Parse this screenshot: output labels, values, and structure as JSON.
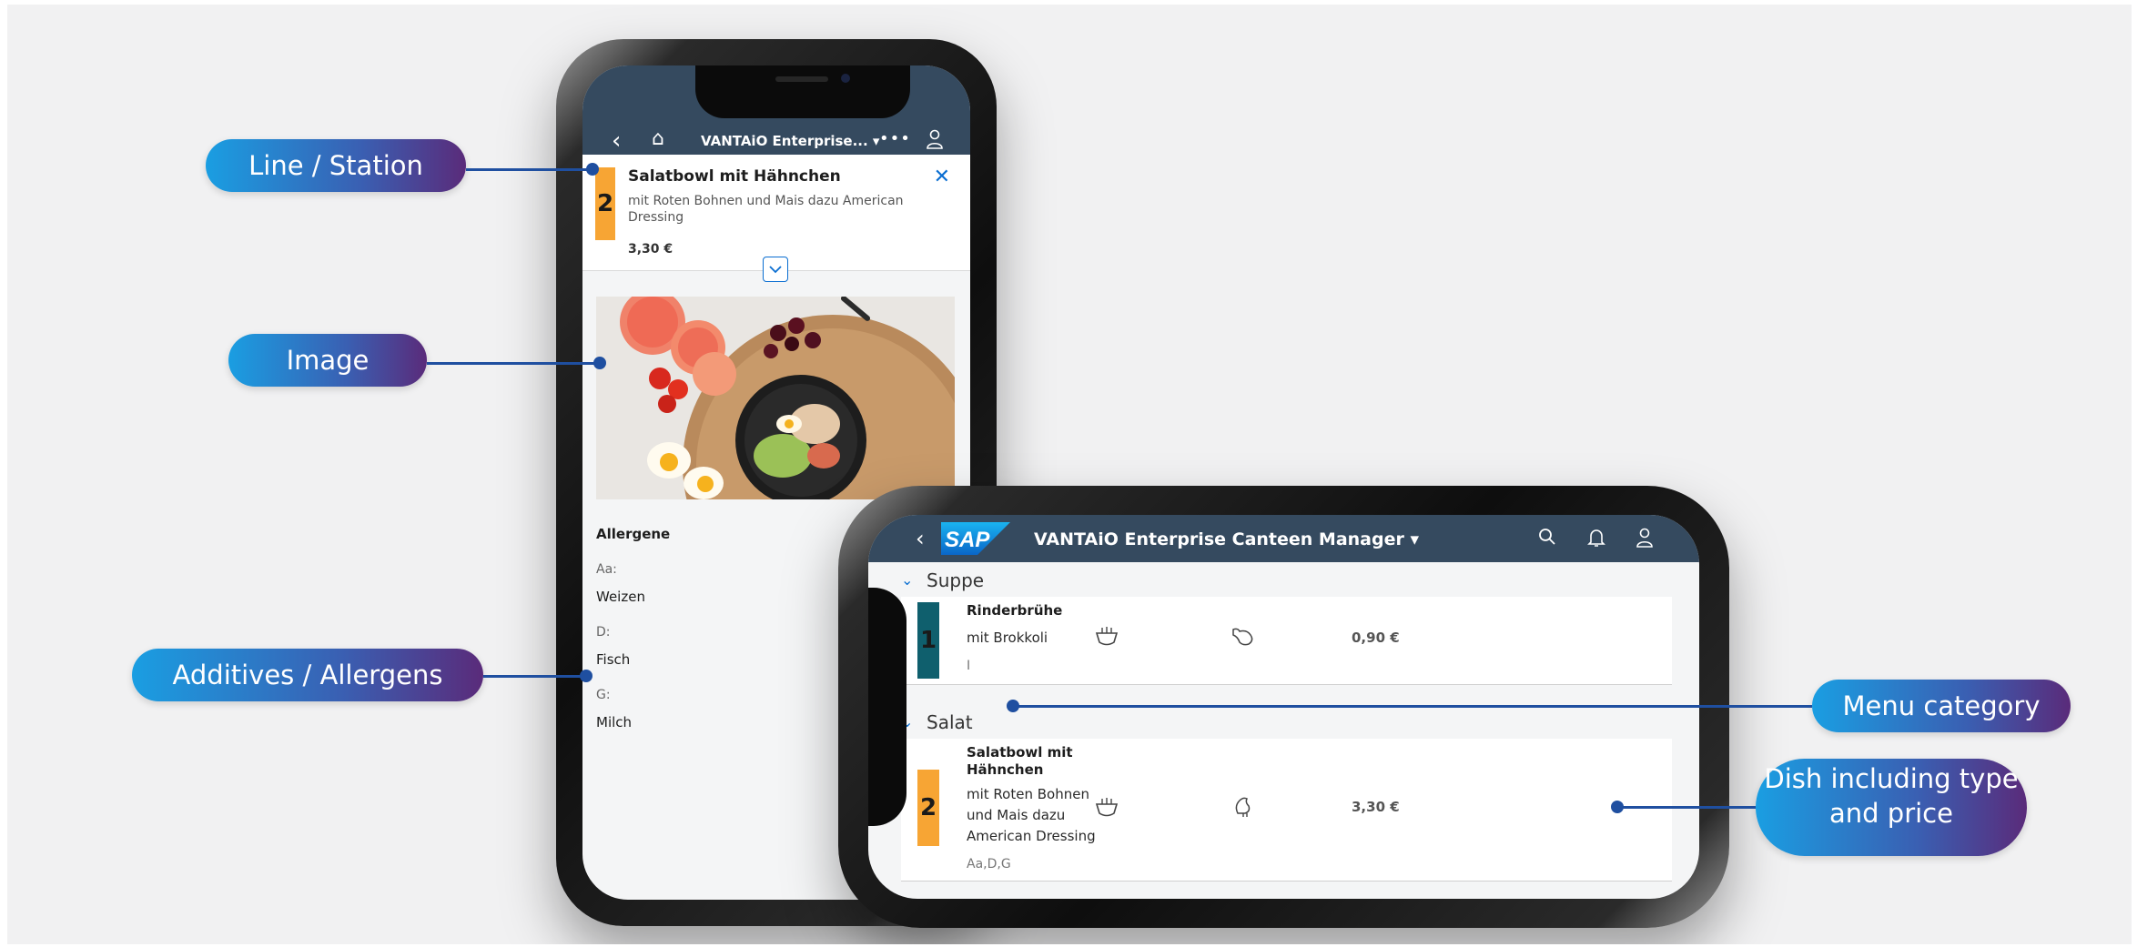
{
  "portrait_app": {
    "shell_title": "VANTAiO Enterprise...",
    "title_caret": "▾",
    "back_icon": "chevron-left-icon",
    "home_icon": "home-icon",
    "more_icon": "overflow-icon",
    "user_icon": "user-icon",
    "dish": {
      "line": "2",
      "title": "Salatbowl mit Hähnchen",
      "description": "mit Roten Bohnen und Mais dazu American Dressing",
      "price": "3,30 €",
      "close_icon": "close-icon"
    },
    "allergens_title": "Allergene",
    "allergens": [
      {
        "code": "Aa:",
        "name": "Weizen"
      },
      {
        "code": "D:",
        "name": "Fisch"
      },
      {
        "code": "G:",
        "name": "Milch"
      }
    ]
  },
  "landscape_app": {
    "logo_text": "SAP",
    "shell_title": "VANTAiO Enterprise Canteen Manager",
    "title_caret": "▾",
    "categories": [
      {
        "label": "Suppe",
        "dishes": [
          {
            "line": "1",
            "line_color": "#0f5f6d",
            "name": "Rinderbrühe",
            "description": "mit Brokkoli",
            "allergens": "I",
            "price": "0,90 €",
            "type_icon": "bowl-icon",
            "meat_icon": "beef-icon"
          }
        ]
      },
      {
        "label": "Salat",
        "dishes": [
          {
            "line": "2",
            "line_color": "#f7a534",
            "name": "Salatbowl mit Hähnchen",
            "description": "mit Roten Bohnen und Mais dazu American Dressing",
            "allergens": "Aa,D,G",
            "price": "3,30 €",
            "type_icon": "bowl-icon",
            "meat_icon": "chicken-icon"
          }
        ]
      }
    ]
  },
  "callouts": {
    "line_station": "Line / Station",
    "image": "Image",
    "additives": "Additives / Allergens",
    "menu_category": "Menu category",
    "dish_type_price": "Dish including type and price"
  },
  "colors": {
    "shellbar": "#354a5f",
    "accent": "#0a6ed1",
    "callout_from": "#1a9ee2",
    "callout_to": "#5a2b7a",
    "leader": "#1f4fa0"
  }
}
